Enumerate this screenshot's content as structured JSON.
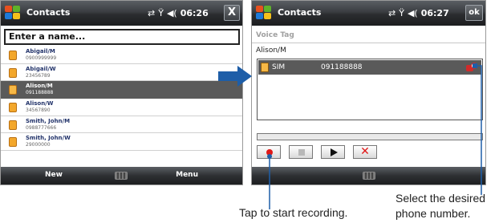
{
  "left_screen": {
    "app_title": "Contacts",
    "time": "06:26",
    "close_label": "X",
    "name_input": {
      "placeholder": "Enter a name..."
    },
    "contacts": [
      {
        "name": "Abigail/M",
        "number": "0900999999",
        "selected": false
      },
      {
        "name": "Abigail/W",
        "number": "23456789",
        "selected": false
      },
      {
        "name": "Alison/M",
        "number": "091188888",
        "selected": true
      },
      {
        "name": "Alison/W",
        "number": "34567890",
        "selected": false
      },
      {
        "name": "Smith, John/M",
        "number": "0988777666",
        "selected": false
      },
      {
        "name": "Smith, John/W",
        "number": "29000000",
        "selected": false
      }
    ],
    "softkey_left": "New",
    "softkey_right": "Menu"
  },
  "right_screen": {
    "app_title": "Contacts",
    "time": "06:27",
    "ok_label": "ok",
    "section_label": "Voice Tag",
    "contact_heading": "Alison/M",
    "number_row": {
      "type": "SIM",
      "number": "091188888"
    },
    "progress": 0
  },
  "icons": {
    "start": "windows-flag-icon",
    "sync": "sync-arrows-icon",
    "signal": "signal-icon",
    "volume": "speaker-icon",
    "contact": "contact-card-icon",
    "sim": "sim-card-icon",
    "voice_tag": "voice-tag-icon",
    "keyboard": "keyboard-icon",
    "record": "record-icon",
    "stop": "stop-icon",
    "play": "play-icon",
    "delete": "delete-icon"
  },
  "colors": {
    "titlebar": "#2b2d30",
    "selection": "#5a5a5a",
    "record_red": "#e01818",
    "arrow_blue": "#1e5ea8"
  },
  "callouts": {
    "record": "Tap to start recording.",
    "phone_line1": "Select the desired",
    "phone_line2": "phone number."
  }
}
